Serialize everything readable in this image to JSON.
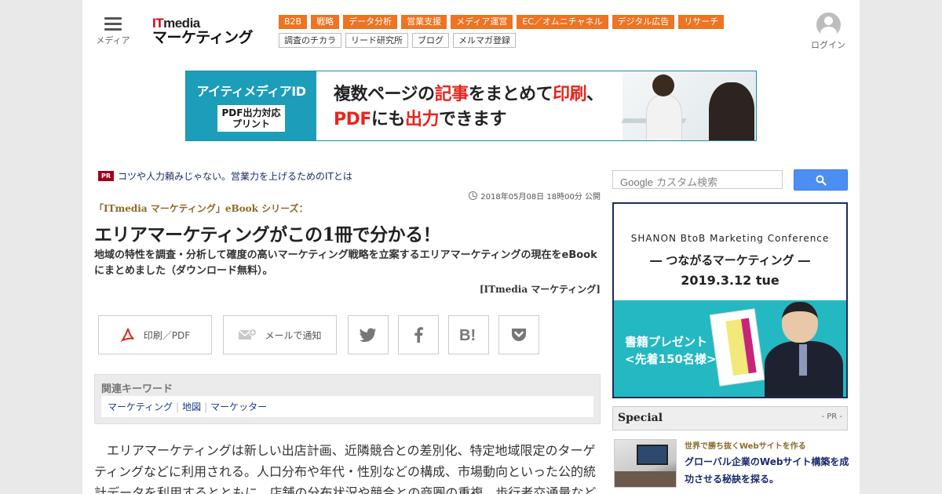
{
  "header": {
    "menu_label": "メディア",
    "logo_top_it": "IT",
    "logo_top_rest": "media",
    "logo_bottom": "マーケティング",
    "nav_primary": [
      "B2B",
      "戦略",
      "データ分析",
      "営業支援",
      "メディア運営",
      "EC／オムニチャネル",
      "デジタル広告",
      "リサーチ"
    ],
    "nav_secondary": [
      "調査のチカラ",
      "リード研究所",
      "ブログ",
      "メルマガ登録"
    ],
    "login_label": "ログイン"
  },
  "banner": {
    "brand": "アイティメディアID",
    "badge_line1": "PDF出力対応",
    "badge_line2": "プリント",
    "line1_a": "複数ページの",
    "line1_b": "記事",
    "line1_c": "をまとめて",
    "line1_d": "印刷",
    "line1_e": "、",
    "line2_a": "PDF",
    "line2_b": "にも",
    "line2_c": "出力",
    "line2_d": "できます"
  },
  "article": {
    "pr_badge": "PR",
    "pr_text": "コツや人力頼みじゃない。営業力を上げるためのITとは",
    "date": "2018年05月08日 18時00分 公開",
    "series": "「ITmedia マーケティング」eBook シリーズ：",
    "title": "エリアマーケティングがこの1冊で分かる！",
    "lead": "地域の特性を調査・分析して確度の高いマーケティング戦略を立案するエリアマーケティングの現在をeBookにまとめました（ダウンロード無料）。",
    "byline": "[ITmedia マーケティング]",
    "share": {
      "print_label": "印刷／PDF",
      "mail_label": "メールで通知"
    },
    "keywords_heading": "関連キーワード",
    "keywords": [
      "マーケティング",
      "地図",
      "マーケッター"
    ],
    "body": "エリアマーケティングは新しい出店計画、近隣競合との差別化、特定地域限定のターゲティングなどに利用される。人口分布や年代・性別などの構成、市場動向といった公的統計データを利用するとともに、店舗の分布状況や競合との商圏の重複、歩行者交通量など"
  },
  "sidebar": {
    "search_placeholder": "カスタム検索",
    "search_google": "Google",
    "ad": {
      "line1": "SHANON BtoB Marketing Conference",
      "line2": "― つながるマーケティング ―",
      "line3": "2019.3.12 tue",
      "gift1": "書籍プレゼント",
      "gift2": "<先着150名様>"
    },
    "special_title": "Special",
    "special_pr": "- PR -",
    "special_item": {
      "kicker": "世界で勝ち抜くWebサイトを作る",
      "title": "グローバル企業のWebサイト構築を成功させる秘訣を探る。"
    }
  },
  "colors": {
    "accent_orange": "#ee7322",
    "banner_teal": "#1c9db9",
    "link_blue": "#1a3a8c",
    "search_blue": "#4d8ef2"
  }
}
